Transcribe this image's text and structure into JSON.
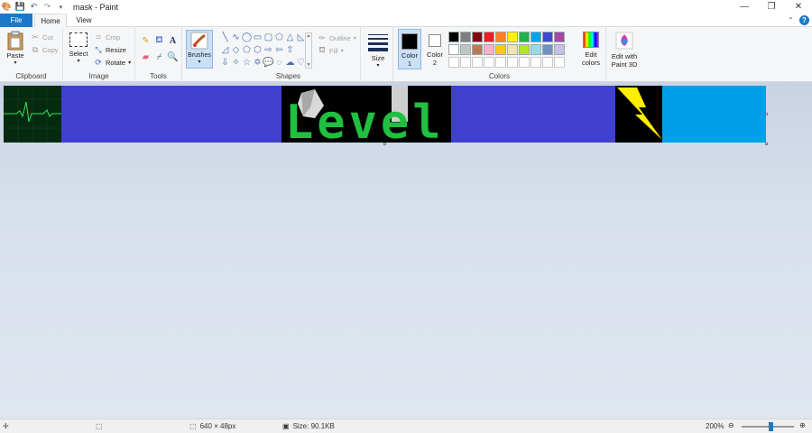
{
  "title": "mask - Paint",
  "tabs": {
    "file": "File",
    "home": "Home",
    "view": "View"
  },
  "clipboard": {
    "paste": "Paste",
    "cut": "Cut",
    "copy": "Copy",
    "label": "Clipboard"
  },
  "image": {
    "select": "Select",
    "crop": "Crop",
    "resize": "Resize",
    "rotate": "Rotate",
    "label": "Image"
  },
  "tools": {
    "label": "Tools"
  },
  "brushes": {
    "label": "Brushes"
  },
  "shapes": {
    "outline": "Outline",
    "fill": "Fill",
    "label": "Shapes"
  },
  "size": {
    "label": "Size"
  },
  "colors": {
    "color1": "Color\n1",
    "color1_a": "Color",
    "color1_b": "1",
    "color2_a": "Color",
    "color2_b": "2",
    "edit_a": "Edit",
    "edit_b": "colors",
    "label": "Colors",
    "color1_value": "#000000",
    "color2_value": "#ffffff",
    "palette_row1": [
      "#000000",
      "#7f7f7f",
      "#880015",
      "#ed1c24",
      "#ff7f27",
      "#fff200",
      "#22b14c",
      "#00a2e8",
      "#3f48cc",
      "#a349a4"
    ],
    "palette_row2": [
      "#ffffff",
      "#c3c3c3",
      "#b97a57",
      "#ffaec9",
      "#ffc90e",
      "#efe4b0",
      "#b5e61d",
      "#99d9ea",
      "#7092be",
      "#c8bfe7"
    ],
    "palette_row3": [
      "#ffffff",
      "#ffffff",
      "#ffffff",
      "#ffffff",
      "#ffffff",
      "#ffffff",
      "#ffffff",
      "#ffffff",
      "#ffffff",
      "#ffffff"
    ]
  },
  "paint3d": {
    "a": "Edit with",
    "b": "Paint 3D"
  },
  "canvas": {
    "text": "Level"
  },
  "status": {
    "dimensions": "640 × 48px",
    "size": "Size: 90.1KB",
    "zoom": "200%",
    "zoom_level": 0.55
  }
}
